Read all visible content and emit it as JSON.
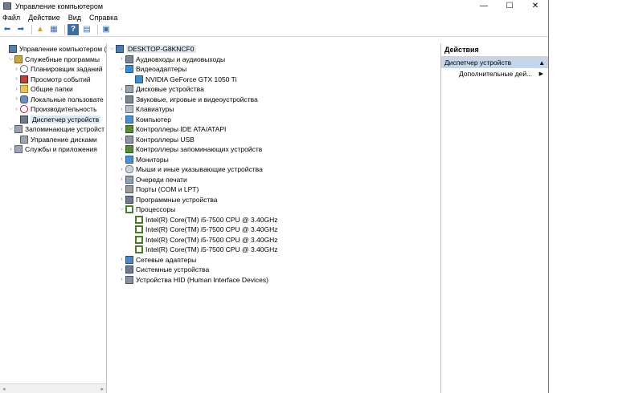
{
  "window": {
    "title": "Управление компьютером",
    "controls": {
      "minimize": "—",
      "maximize": "☐",
      "close": "✕"
    }
  },
  "menu": [
    "Файл",
    "Действие",
    "Вид",
    "Справка"
  ],
  "toolbar": {
    "back": "⬅",
    "forward": "➡",
    "up": "▲",
    "show": "▦",
    "help": "?",
    "props": "▤",
    "monitor": "▣"
  },
  "left_tree": [
    {
      "label": "Управление компьютером (л",
      "indent": 0,
      "expander": "",
      "icon": "i-comp"
    },
    {
      "label": "Служебные программы",
      "indent": 1,
      "expander": "⌵",
      "icon": "i-tool"
    },
    {
      "label": "Планировщик заданий",
      "indent": 2,
      "expander": "›",
      "icon": "i-clock"
    },
    {
      "label": "Просмотр событий",
      "indent": 2,
      "expander": "›",
      "icon": "i-log"
    },
    {
      "label": "Общие папки",
      "indent": 2,
      "expander": "›",
      "icon": "i-folder"
    },
    {
      "label": "Локальные пользовате",
      "indent": 2,
      "expander": "›",
      "icon": "i-users"
    },
    {
      "label": "Производительность",
      "indent": 2,
      "expander": "›",
      "icon": "i-perf"
    },
    {
      "label": "Диспетчер устройств",
      "indent": 2,
      "expander": "",
      "icon": "i-dev",
      "selected": true
    },
    {
      "label": "Запоминающие устройст",
      "indent": 1,
      "expander": "⌵",
      "icon": "i-disk"
    },
    {
      "label": "Управление дисками",
      "indent": 2,
      "expander": "",
      "icon": "i-disk"
    },
    {
      "label": "Службы и приложения",
      "indent": 1,
      "expander": "›",
      "icon": "i-svc"
    }
  ],
  "left_scroll": {
    "left": "◂",
    "right": "▸"
  },
  "device_tree": [
    {
      "label": "DESKTOP-G8KNCF0",
      "indent": 0,
      "expander": "⌵",
      "icon": "i-root",
      "selected": true
    },
    {
      "label": "Аудиовходы и аудиовыходы",
      "indent": 1,
      "expander": "›",
      "icon": "i-audio"
    },
    {
      "label": "Видеоадаптеры",
      "indent": 1,
      "expander": "⌵",
      "icon": "i-display"
    },
    {
      "label": "NVIDIA GeForce GTX 1050 Ti",
      "indent": 2,
      "expander": "",
      "icon": "i-display"
    },
    {
      "label": "Дисковые устройства",
      "indent": 1,
      "expander": "›",
      "icon": "i-disk"
    },
    {
      "label": "Звуковые, игровые и видеоустройства",
      "indent": 1,
      "expander": "›",
      "icon": "i-audio"
    },
    {
      "label": "Клавиатуры",
      "indent": 1,
      "expander": "›",
      "icon": "i-kbd"
    },
    {
      "label": "Компьютер",
      "indent": 1,
      "expander": "›",
      "icon": "i-mon"
    },
    {
      "label": "Контроллеры IDE ATA/ATAPI",
      "indent": 1,
      "expander": "›",
      "icon": "i-chip"
    },
    {
      "label": "Контроллеры USB",
      "indent": 1,
      "expander": "›",
      "icon": "i-usb"
    },
    {
      "label": "Контроллеры запоминающих устройств",
      "indent": 1,
      "expander": "›",
      "icon": "i-chip"
    },
    {
      "label": "Мониторы",
      "indent": 1,
      "expander": "›",
      "icon": "i-mon"
    },
    {
      "label": "Мыши и иные указывающие устройства",
      "indent": 1,
      "expander": "›",
      "icon": "i-mouse"
    },
    {
      "label": "Очереди печати",
      "indent": 1,
      "expander": "›",
      "icon": "i-print"
    },
    {
      "label": "Порты (COM и LPT)",
      "indent": 1,
      "expander": "›",
      "icon": "i-port"
    },
    {
      "label": "Программные устройства",
      "indent": 1,
      "expander": "›",
      "icon": "i-dev"
    },
    {
      "label": "Процессоры",
      "indent": 1,
      "expander": "⌵",
      "icon": "i-cpu"
    },
    {
      "label": "Intel(R) Core(TM) i5-7500 CPU @ 3.40GHz",
      "indent": 2,
      "expander": "",
      "icon": "i-cpu"
    },
    {
      "label": "Intel(R) Core(TM) i5-7500 CPU @ 3.40GHz",
      "indent": 2,
      "expander": "",
      "icon": "i-cpu"
    },
    {
      "label": "Intel(R) Core(TM) i5-7500 CPU @ 3.40GHz",
      "indent": 2,
      "expander": "",
      "icon": "i-cpu"
    },
    {
      "label": "Intel(R) Core(TM) i5-7500 CPU @ 3.40GHz",
      "indent": 2,
      "expander": "",
      "icon": "i-cpu"
    },
    {
      "label": "Сетевые адаптеры",
      "indent": 1,
      "expander": "›",
      "icon": "i-net"
    },
    {
      "label": "Системные устройства",
      "indent": 1,
      "expander": "›",
      "icon": "i-dev"
    },
    {
      "label": "Устройства HID (Human Interface Devices)",
      "indent": 1,
      "expander": "›",
      "icon": "i-hid"
    }
  ],
  "actions": {
    "header": "Действия",
    "section": "Диспетчер устройств",
    "section_arrow": "▲",
    "item": "Дополнительные дей...",
    "item_arrow": "▶"
  }
}
